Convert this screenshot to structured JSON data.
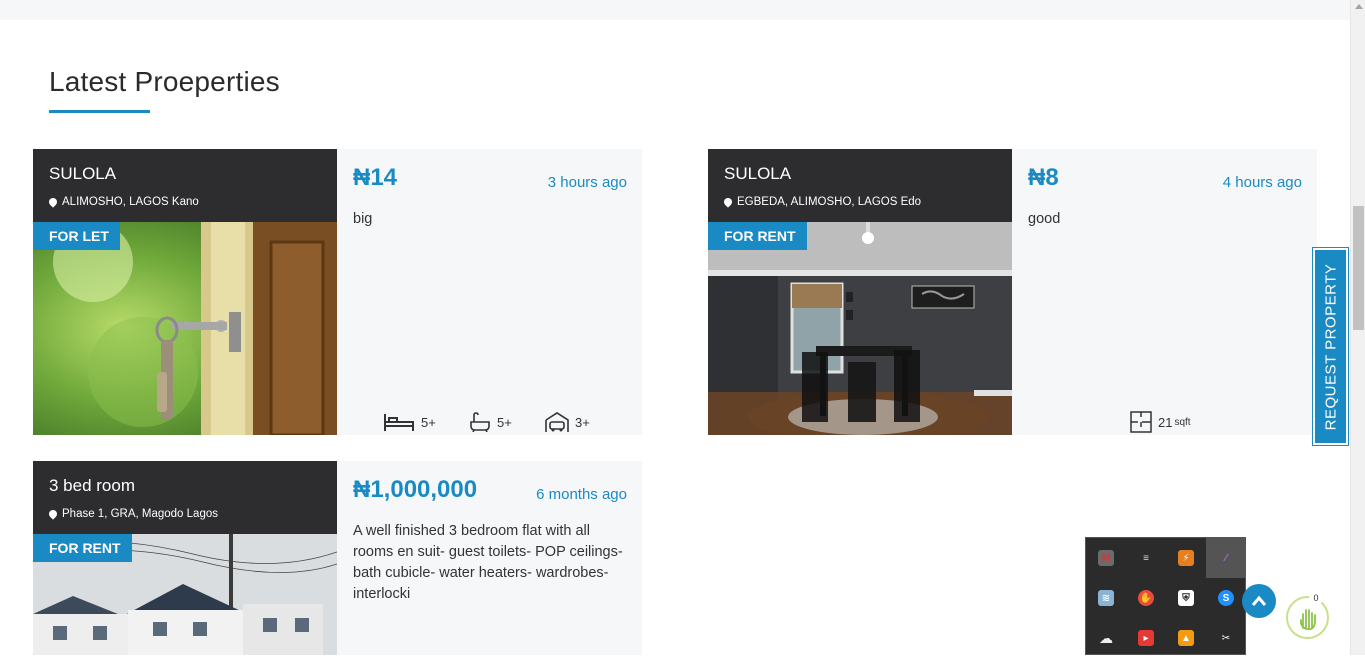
{
  "section": {
    "title": "Latest Proeperties"
  },
  "listings": [
    {
      "name": "SULOLA",
      "location": "ALIMOSHO, LAGOS Kano",
      "badge": "FOR LET",
      "price": "₦14",
      "time": "3 hours ago",
      "description": "big",
      "features": {
        "beds": "5+",
        "baths": "5+",
        "garages": "3+"
      }
    },
    {
      "name": "SULOLA",
      "location": "EGBEDA, ALIMOSHO, LAGOS Edo",
      "badge": "FOR RENT",
      "price": "₦8",
      "time": "4 hours ago",
      "description": "good",
      "features": {
        "area": "21",
        "area_unit": "sqft"
      }
    },
    {
      "name": "3 bed room",
      "location": "Phase 1, GRA, Magodo Lagos",
      "badge": "FOR RENT",
      "price": "₦1,000,000",
      "time": "6 months ago",
      "description": "A well finished 3 bedroom flat with all rooms en suit- guest toilets- POP ceilings- bath cubicle- water heaters- wardrobes- interlocki"
    }
  ],
  "request_tab": {
    "label": "REQUEST PROPERTY"
  },
  "hand_widget": {
    "count": "0"
  },
  "colors": {
    "accent": "#1a8ac4",
    "dark_panel": "#2d2d30",
    "card_bg": "#f6f7f9"
  },
  "tray_icons": [
    "mcafee-icon",
    "network-icon",
    "orange-app-icon",
    "feather-icon",
    "disk-icon",
    "hand-red-icon",
    "shield-icon",
    "skype-icon",
    "cloud-icon",
    "red-app-icon",
    "vlc-icon",
    "snip-icon"
  ]
}
